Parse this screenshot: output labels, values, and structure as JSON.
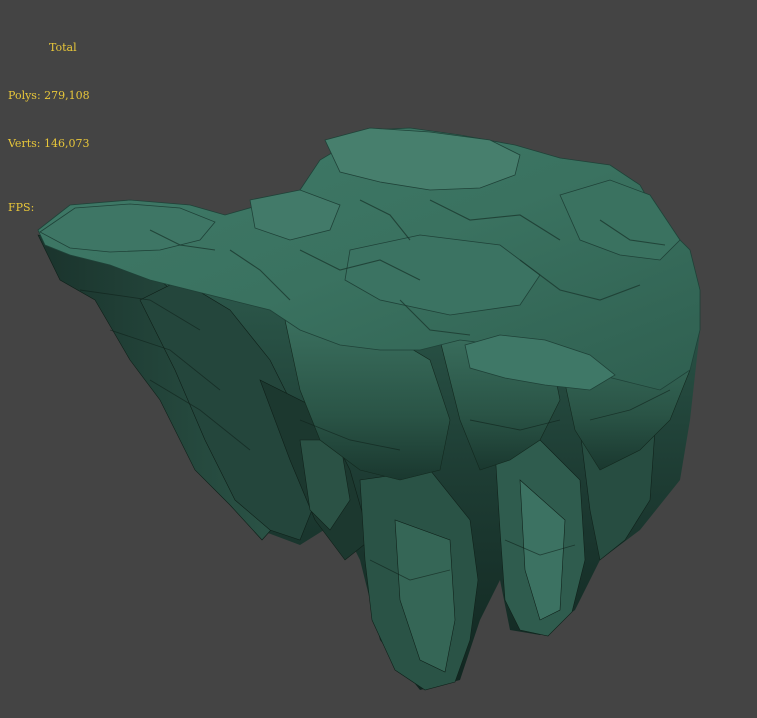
{
  "stats": {
    "total_label": "Total",
    "polys_label": "Polys:",
    "polys_value": "279,108",
    "verts_label": "Verts:",
    "verts_value": "146,073",
    "fps_label": "FPS:",
    "text_color": "#e8c73a"
  },
  "viewport": {
    "background_color": "#444444",
    "model": "floating-rock-island"
  }
}
